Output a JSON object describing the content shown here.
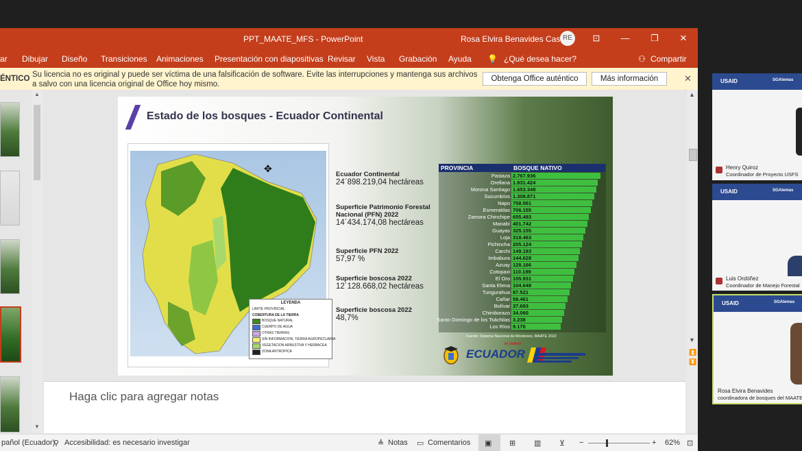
{
  "window": {
    "title": "PPT_MAATE_MFS  -  PowerPoint",
    "user": "Rosa Elvira Benavides Castro",
    "user_initials": "RE",
    "accent": "#c43e1c"
  },
  "ribbon": {
    "tabs": [
      "ar",
      "Dibujar",
      "Diseño",
      "Transiciones",
      "Animaciones",
      "Presentación con diapositivas",
      "Revisar",
      "Vista",
      "Grabación",
      "Ayuda"
    ],
    "tellme": "¿Qué desea hacer?",
    "share": "Compartir"
  },
  "notice": {
    "label": "ÉNTICO",
    "message": "Su licencia no es original y puede ser víctima de una falsificación de software. Evite las interrupciones y mantenga sus archivos a salvo con una licencia original de Office hoy mismo.",
    "btn_genuine": "Obtenga Office auténtico",
    "btn_more": "Más información"
  },
  "slide": {
    "title": "Estado de los bosques  - Ecuador Continental",
    "legend": {
      "title": "LEYENDA",
      "limit": "LIMITE PROVINCIAL",
      "heading": "COBERTURA DE LA TIERRA",
      "items": [
        {
          "label": "BOSQUE NATURAL",
          "color": "#3a8a1e"
        },
        {
          "label": "CUERPO DE AGUA",
          "color": "#3b6fd1"
        },
        {
          "label": "OTRAS TIERRAS",
          "color": "#c9a9e8"
        },
        {
          "label": "SIN INFORMACION, TIERRA AGROPECUARIA",
          "color": "#f3ef6a"
        },
        {
          "label": "VEGETACION ARBUSTIVA Y HERBACEA",
          "color": "#a7d86b"
        },
        {
          "label": "ZONA ANTROPICA",
          "color": "#222222"
        }
      ]
    },
    "stats": [
      {
        "label": "Ecuador Continental",
        "value": "24´898.219,04 hectáreas"
      },
      {
        "label": "Superficie Patrimonio Forestal Nacional (PFN)  2022",
        "value": "14´434.174,08 hectáreas"
      },
      {
        "label": "Superficie PFN 2022",
        "value": "57,97 %"
      },
      {
        "label": "Superficie boscosa 2022",
        "value": "12´128.668,02 hectáreas"
      },
      {
        "label": "Superficie boscosa 2022",
        "value": "48,7%"
      }
    ],
    "table": {
      "col1": "PROVINCIA",
      "col2": "BOSQUE NATIVO",
      "rows": [
        {
          "provincia": "Pastaza",
          "bosque": "2.767.936",
          "frac": 1.0
        },
        {
          "provincia": "Orellana",
          "bosque": "1.831.424",
          "frac": 0.97
        },
        {
          "provincia": "Morona Santiago",
          "bosque": "1.653.348",
          "frac": 0.95
        },
        {
          "provincia": "Sucumbíos",
          "bosque": "1.308.871",
          "frac": 0.93
        },
        {
          "provincia": "Napo",
          "bosque": "758.561",
          "frac": 0.91
        },
        {
          "provincia": "Esmeraldas",
          "bosque": "706.155",
          "frac": 0.89
        },
        {
          "provincia": "Zamora Chinchipe",
          "bosque": "655.483",
          "frac": 0.87
        },
        {
          "provincia": "Manabí",
          "bosque": "401.742",
          "frac": 0.85
        },
        {
          "provincia": "Guayas",
          "bosque": "325.155",
          "frac": 0.83
        },
        {
          "provincia": "Loja",
          "bosque": "318.463",
          "frac": 0.81
        },
        {
          "provincia": "Pichincha",
          "bosque": "205.124",
          "frac": 0.79
        },
        {
          "provincia": "Carchi",
          "bosque": "149.183",
          "frac": 0.77
        },
        {
          "provincia": "Imbabura",
          "bosque": "144.628",
          "frac": 0.75
        },
        {
          "provincia": "Azuay",
          "bosque": "128.166",
          "frac": 0.73
        },
        {
          "provincia": "Cotopaxi",
          "bosque": "110.189",
          "frac": 0.71
        },
        {
          "provincia": "El Oro",
          "bosque": "105.931",
          "frac": 0.69
        },
        {
          "provincia": "Santa Elena",
          "bosque": "104.648",
          "frac": 0.67
        },
        {
          "provincia": "Tungurahua",
          "bosque": "87.521",
          "frac": 0.65
        },
        {
          "provincia": "Cañar",
          "bosque": "58.461",
          "frac": 0.63
        },
        {
          "provincia": "Bolívar",
          "bosque": "37.683",
          "frac": 0.61
        },
        {
          "provincia": "Chimborazo",
          "bosque": "34.060",
          "frac": 0.59
        },
        {
          "provincia": "Santo Domingo de los Tsáchilas",
          "bosque": "3.238",
          "frac": 0.57
        },
        {
          "provincia": "Los Ríos",
          "bosque": "9.170",
          "frac": 0.55
        }
      ],
      "source": "Fuente: Sistema Nacional de Monitoreo, MAATE 2022"
    },
    "logo_text": "ECUADOR",
    "logo_kicker": "el nuevo"
  },
  "notes": {
    "placeholder": "Haga clic para agregar notas"
  },
  "status": {
    "language": "pañol (Ecuador)",
    "accessibility": "Accesibilidad: es necesario investigar",
    "notes": "Notas",
    "comments": "Comentarios",
    "zoom_minus": "−",
    "zoom_plus": "+",
    "zoom": "62%"
  },
  "participants": [
    {
      "name": "Henry Quiroz",
      "role": "Coordinador de Proyecto USFS"
    },
    {
      "name": "Luis Ordóñez",
      "role": "Coordinador de Manejo Forestal"
    },
    {
      "name": "Rosa Elvira Benavides",
      "role": "coordinadora de bosques del MAATE"
    }
  ],
  "tile_band": {
    "usaid": "USAID",
    "partner": "SGAtemas"
  }
}
